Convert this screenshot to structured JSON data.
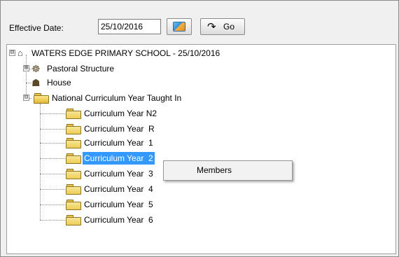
{
  "toolbar": {
    "effective_date_label": "Effective Date:",
    "effective_date_value": "25/10/2016",
    "calendar_icon": "calendar-icon",
    "go_label": "Go",
    "go_icon": "go-arrow-icon"
  },
  "tree": {
    "root": {
      "label": "WATERS EDGE PRIMARY SCHOOL - 25/10/2016",
      "expander": "⊟",
      "icon": "school-icon"
    },
    "groups": [
      {
        "label": "Pastoral Structure",
        "expander": "⊞",
        "icon": "people-icon"
      },
      {
        "label": "House",
        "icon": "house-icon"
      },
      {
        "label": "National Curriculum Year Taught In",
        "expander": "⊟",
        "icon": "folder-icon"
      }
    ],
    "curriculum_years": [
      {
        "label": "Curriculum Year N2",
        "selected": false
      },
      {
        "label": "Curriculum Year  R",
        "selected": false
      },
      {
        "label": "Curriculum Year  1",
        "selected": false
      },
      {
        "label": "Curriculum Year  2",
        "selected": true
      },
      {
        "label": "Curriculum Year  3",
        "selected": false
      },
      {
        "label": "Curriculum Year  4",
        "selected": false
      },
      {
        "label": "Curriculum Year  5",
        "selected": false
      },
      {
        "label": "Curriculum Year  6",
        "selected": false
      }
    ]
  },
  "context_menu": {
    "items": [
      {
        "label": "Members"
      }
    ]
  },
  "colors": {
    "selection": "#3399ff",
    "background": "#f0f0f0"
  }
}
